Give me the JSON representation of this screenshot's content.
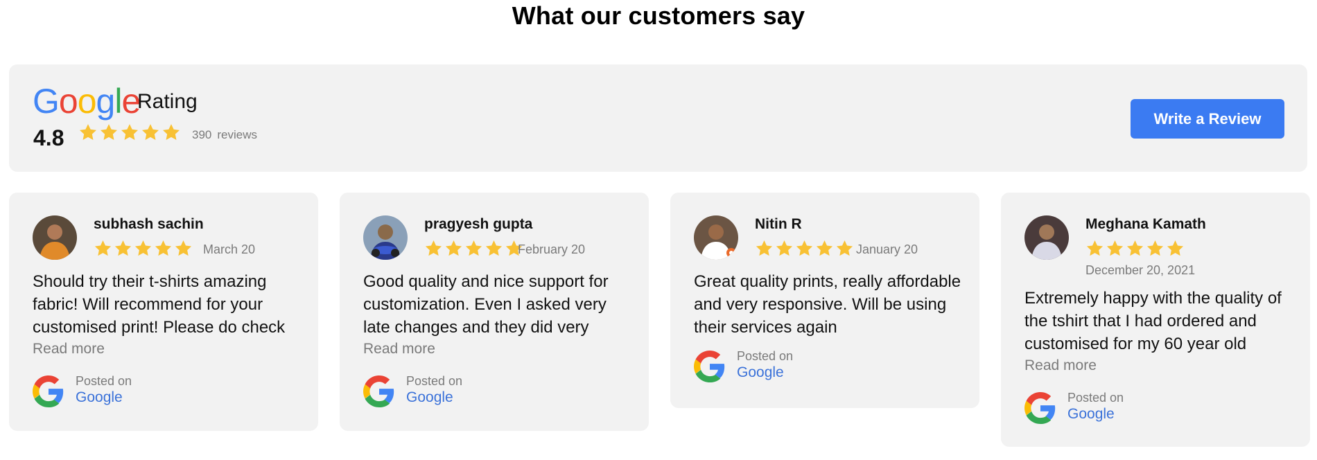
{
  "heading": "What our customers say",
  "summary": {
    "logo_letters": [
      {
        "ch": "G",
        "color": "#4285F4"
      },
      {
        "ch": "o",
        "color": "#EA4335"
      },
      {
        "ch": "o",
        "color": "#FBBC05"
      },
      {
        "ch": "g",
        "color": "#4285F4"
      },
      {
        "ch": "l",
        "color": "#34A853"
      },
      {
        "ch": "e",
        "color": "#EA4335"
      }
    ],
    "rating_label": "Rating",
    "average": "4.8",
    "review_count": "390",
    "reviews_label": "reviews",
    "stars": 5,
    "write_button": "Write a Review"
  },
  "colors": {
    "star": "#F8C134",
    "button": "#3b7bf2",
    "link": "#3b72d9",
    "card_bg": "#f2f2f2"
  },
  "reviews": [
    {
      "name": "subhash sachin",
      "date": "March 20",
      "stars": 5,
      "text": "Should try their t-shirts amazing fabric! Will recommend for your customised print! Please do check",
      "read_more": "Read more",
      "posted_on": "Posted on",
      "source": "Google",
      "avatar_icon": "person-with-orange-shirt-avatar"
    },
    {
      "name": "pragyesh gupta",
      "date": "February 20",
      "stars": 5,
      "text": "Good quality and nice support for customization. Even I asked very late changes and they did very",
      "read_more": "Read more",
      "posted_on": "Posted on",
      "source": "Google",
      "avatar_icon": "person-on-motorcycle-avatar"
    },
    {
      "name": "Nitin R",
      "date": "January 20",
      "stars": 5,
      "text": "Great quality prints, really affordable and very responsive. Will be using their services again",
      "read_more": "",
      "posted_on": "Posted on",
      "source": "Google",
      "avatar_icon": "smiling-man-avatar"
    },
    {
      "name": "Meghana Kamath",
      "date": "December 20, 2021",
      "stars": 5,
      "text": "Extremely happy with the quality of the tshirt that I had ordered and customised for my 60 year old",
      "read_more": "Read more",
      "posted_on": "Posted on",
      "source": "Google",
      "avatar_icon": "woman-avatar"
    }
  ]
}
